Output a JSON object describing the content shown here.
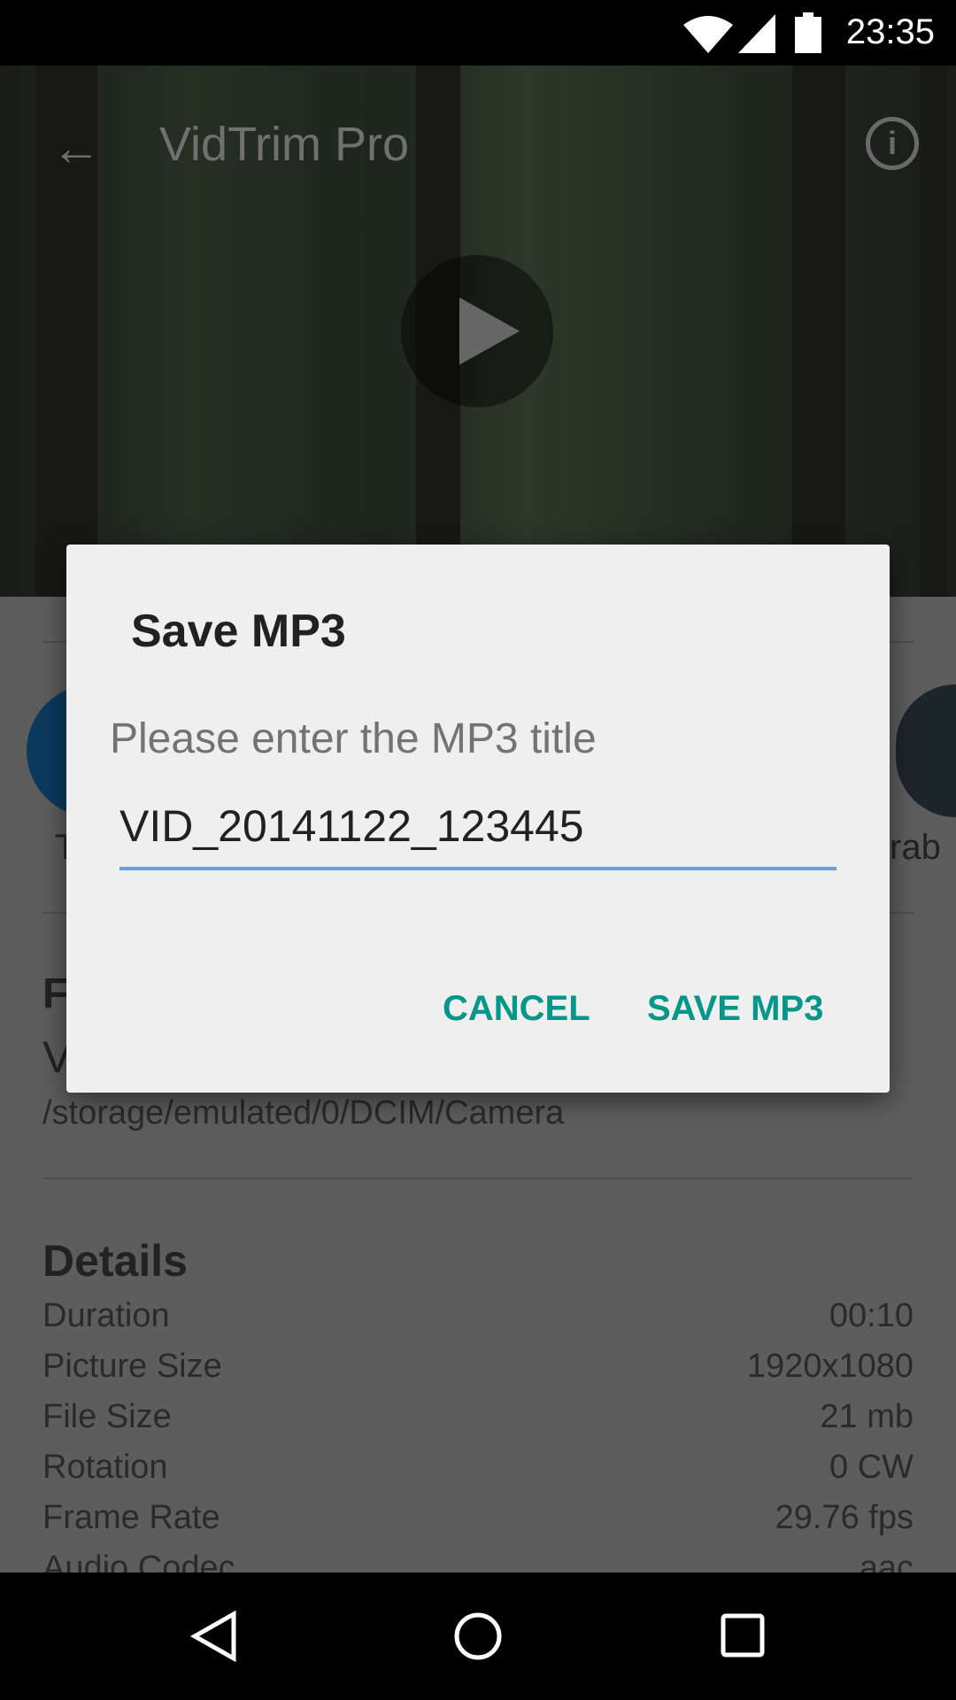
{
  "status_bar": {
    "time": "23:35",
    "icons": [
      "wifi-icon",
      "signal-icon",
      "battery-icon"
    ]
  },
  "app_bar": {
    "title": "VidTrim Pro",
    "back_icon": "arrow-left-icon",
    "info_icon": "info-icon"
  },
  "video": {
    "play_icon": "play-icon"
  },
  "actions": {
    "left_label": "T",
    "right_label": "rab"
  },
  "file": {
    "heading": "F",
    "name": "V",
    "path": "/storage/emulated/0/DCIM/Camera"
  },
  "details": {
    "heading": "Details",
    "rows": [
      {
        "label": "Duration",
        "value": "00:10"
      },
      {
        "label": "Picture Size",
        "value": "1920x1080"
      },
      {
        "label": "File Size",
        "value": "21 mb"
      },
      {
        "label": "Rotation",
        "value": "0 CW"
      },
      {
        "label": "Frame Rate",
        "value": "29.76 fps"
      },
      {
        "label": "Audio Codec",
        "value": "aac"
      }
    ]
  },
  "dialog": {
    "title": "Save MP3",
    "prompt": "Please enter the MP3 title",
    "input_value": "VID_20141122_123445",
    "cancel_label": "CANCEL",
    "confirm_label": "SAVE MP3",
    "accent_color": "#009688"
  },
  "nav_bar": {
    "icons": [
      "back-triangle-icon",
      "home-circle-icon",
      "recents-square-icon"
    ]
  }
}
